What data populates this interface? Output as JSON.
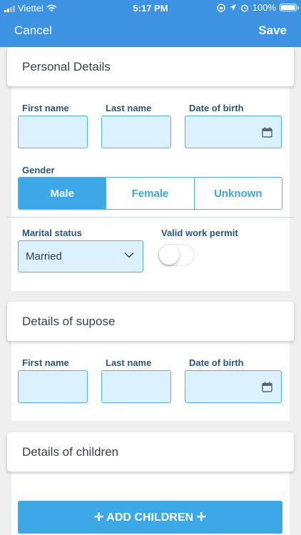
{
  "status_bar": {
    "carrier": "Viettel",
    "time": "5:17 PM",
    "battery": "100%",
    "icons": [
      "signal-icon",
      "wifi-icon",
      "screen-lock-icon",
      "location-arrow-icon",
      "alarm-icon",
      "battery-icon"
    ]
  },
  "nav": {
    "cancel_label": "Cancel",
    "save_label": "Save"
  },
  "personal": {
    "title": "Personal Details",
    "first_name_label": "First name",
    "last_name_label": "Last name",
    "dob_label": "Date of birth",
    "gender_label": "Gender",
    "gender_options": [
      "Male",
      "Female",
      "Unknown"
    ],
    "gender_selected": "Male",
    "marital_label": "Marital status",
    "marital_value": "Married",
    "work_permit_label": "Valid work permit",
    "work_permit_on": false
  },
  "spouse": {
    "title": "Details of supose",
    "first_name_label": "First name",
    "last_name_label": "Last name",
    "dob_label": "Date of birth"
  },
  "children": {
    "title": "Details of children",
    "add_label": "✛ ADD CHILDREN ✛"
  },
  "colors": {
    "nav_blue": "#3d92e2",
    "accent": "#3ca9e6",
    "field_bg": "#dcf1fe",
    "field_border": "#4fb3e8",
    "label_text": "#2c5577"
  }
}
